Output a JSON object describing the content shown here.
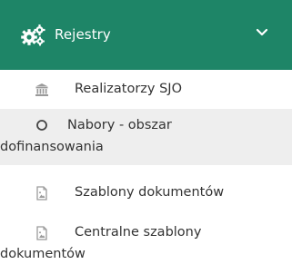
{
  "menu": {
    "header": {
      "label": "Rejestry",
      "icon": "cogs-icon",
      "expand_icon": "chevron-down-icon"
    },
    "items": [
      {
        "label": "Realizatorzy SJO",
        "icon": "bank-icon"
      },
      {
        "label_line1": "Nabory - obszar",
        "label_line2": "dofinansowania",
        "icon": "circle-o-icon",
        "selected": true
      },
      {
        "label": "Szablony dokumentów",
        "icon": "file-image-icon"
      },
      {
        "label_line1": "Centralne szablony",
        "label_line2": "dokumentów",
        "icon": "file-image-icon"
      }
    ]
  },
  "colors": {
    "header_bg": "#1e8567",
    "selected_bg": "#eeeeee",
    "text": "#333333",
    "icon": "#9a9a9a"
  }
}
